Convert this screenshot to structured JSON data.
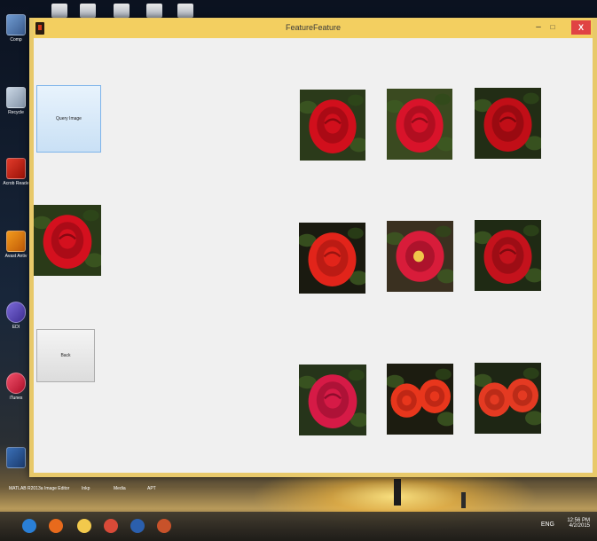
{
  "window": {
    "title": "FeatureFeature",
    "controls": {
      "minimize": "–",
      "maximize": "□",
      "close": "X"
    }
  },
  "buttons": {
    "query_image": "Query Image",
    "back": "Back"
  },
  "desktop": {
    "icons": [
      {
        "label": "Comp",
        "icon": "computer-icon"
      },
      {
        "label": "Recycle",
        "icon": "recycle-bin-icon"
      },
      {
        "label": "Acrob Reade",
        "icon": "acrobat-icon"
      },
      {
        "label": "Avast Antiv",
        "icon": "antivirus-icon"
      },
      {
        "label": "EDI",
        "icon": "app-icon"
      },
      {
        "label": "iTunes",
        "icon": "itunes-icon"
      },
      {
        "label": "MATLAB R2013a",
        "icon": "matlab-icon"
      }
    ],
    "bottom_labels": [
      "MATLAB R2013a",
      "Image Editor",
      "Inkp",
      "Media",
      "APT"
    ]
  },
  "taskbar": {
    "apps": [
      {
        "name": "internet-explorer-icon",
        "color": "#2a7fd6"
      },
      {
        "name": "firefox-icon",
        "color": "#e86a1c"
      },
      {
        "name": "file-explorer-icon",
        "color": "#f2c94c"
      },
      {
        "name": "chrome-icon",
        "color": "#d94a38"
      },
      {
        "name": "word-icon",
        "color": "#2b5fad"
      },
      {
        "name": "matlab-icon",
        "color": "#c8522a"
      }
    ],
    "tray": {
      "lang": "ENG",
      "time": "12:56 PM",
      "date": "4/2/2015"
    }
  },
  "results": [
    {
      "id": 1,
      "kind": "single-rose",
      "bg": "#2b3a1a",
      "petal": "#d10f1c",
      "dark": "#8a0810"
    },
    {
      "id": 2,
      "kind": "single-rose",
      "bg": "#3a4a20",
      "petal": "#d9132a",
      "dark": "#8f0b18"
    },
    {
      "id": 3,
      "kind": "single-rose",
      "bg": "#222d15",
      "petal": "#c10e17",
      "dark": "#7a070d"
    },
    {
      "id": 4,
      "kind": "single-rose",
      "bg": "#1a1a10",
      "petal": "#e2241a",
      "dark": "#9a1410"
    },
    {
      "id": 5,
      "kind": "open-rose",
      "bg": "#3a3020",
      "petal": "#d81c3a",
      "dark": "#8a0c20"
    },
    {
      "id": 6,
      "kind": "single-rose",
      "bg": "#1f2a14",
      "petal": "#c4121c",
      "dark": "#7e0a10"
    },
    {
      "id": 7,
      "kind": "single-rose",
      "bg": "#26341a",
      "petal": "#d61a46",
      "dark": "#8e0c2c"
    },
    {
      "id": 8,
      "kind": "double-rose",
      "bg": "#1c1c10",
      "petal": "#e8361c",
      "dark": "#a41e10"
    },
    {
      "id": 9,
      "kind": "double-rose",
      "bg": "#1e2614",
      "petal": "#e43a22",
      "dark": "#a02212"
    }
  ],
  "query": {
    "kind": "single-rose",
    "bg": "#2a3a18",
    "petal": "#d4101e",
    "dark": "#880812"
  }
}
